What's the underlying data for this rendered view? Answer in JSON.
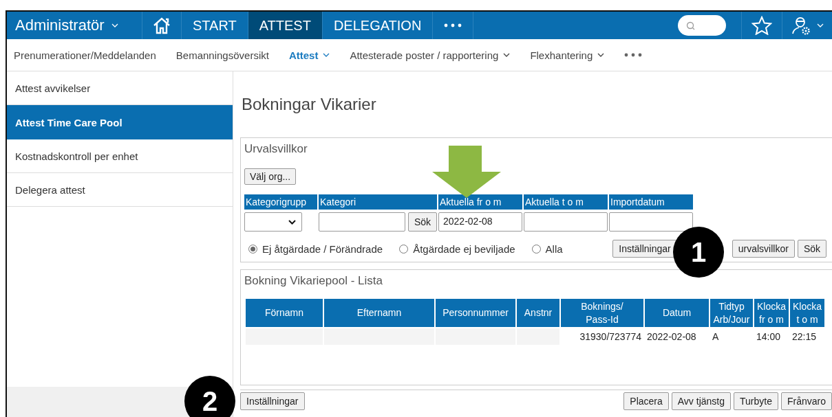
{
  "nav": {
    "account": "Administratör",
    "tabs": [
      {
        "label": "START",
        "selected": false
      },
      {
        "label": "ATTEST",
        "selected": true
      },
      {
        "label": "DELEGATION",
        "selected": false
      }
    ]
  },
  "subnav": [
    {
      "label": "Prenumerationer/Meddelanden",
      "selected": false,
      "dropdown": false
    },
    {
      "label": "Bemanningsöversikt",
      "selected": false,
      "dropdown": false
    },
    {
      "label": "Attest",
      "selected": true,
      "dropdown": true
    },
    {
      "label": "Attesterade poster / rapportering",
      "selected": false,
      "dropdown": true
    },
    {
      "label": "Flexhantering",
      "selected": false,
      "dropdown": true
    }
  ],
  "sidebar": {
    "items": [
      {
        "label": "Attest avvikelser",
        "selected": false
      },
      {
        "label": "Attest Time Care Pool",
        "selected": true
      },
      {
        "label": "Kostnadskontroll per enhet",
        "selected": false
      },
      {
        "label": "Delegera attest",
        "selected": false
      }
    ]
  },
  "page_title": "Bokningar Vikarier",
  "filter": {
    "title": "Urvalsvillkor",
    "org_button": "Välj org...",
    "columns": [
      "Kategorigrupp",
      "Kategori",
      "Aktuella fr o m",
      "Aktuella t o m",
      "Importdatum"
    ],
    "kategori_search": "Sök",
    "from_value": "2022-02-08",
    "radios": [
      {
        "label": "Ej åtgärdade / Förändrade",
        "selected": true
      },
      {
        "label": "Åtgärdade ej beviljade",
        "selected": false
      },
      {
        "label": "Alla",
        "selected": false
      }
    ],
    "buttons": [
      "Inställningar",
      "urvalsvillkor",
      "Sök"
    ]
  },
  "list": {
    "title": "Bokning Vikariepool - Lista",
    "columns": [
      "Förnamn",
      "Efternamn",
      "Personnummer",
      "Anstnr",
      "Boknings/\nPass-Id",
      "Datum",
      "Tidtyp\nArb/Jour",
      "Klocka\nfr o m",
      "Klocka\nt o m"
    ],
    "rows": [
      {
        "booking_pass_id": "31930/723774",
        "datum": "2022-02-08",
        "tidtyp": "A",
        "klocka_from": "14:00",
        "klocka_tom": "22:15"
      }
    ]
  },
  "footer": {
    "left_button": "Inställningar",
    "right_buttons": [
      "Placera",
      "Avv tjänstg",
      "Turbyte",
      "Frånvaro"
    ]
  },
  "callouts": [
    "1",
    "2"
  ]
}
